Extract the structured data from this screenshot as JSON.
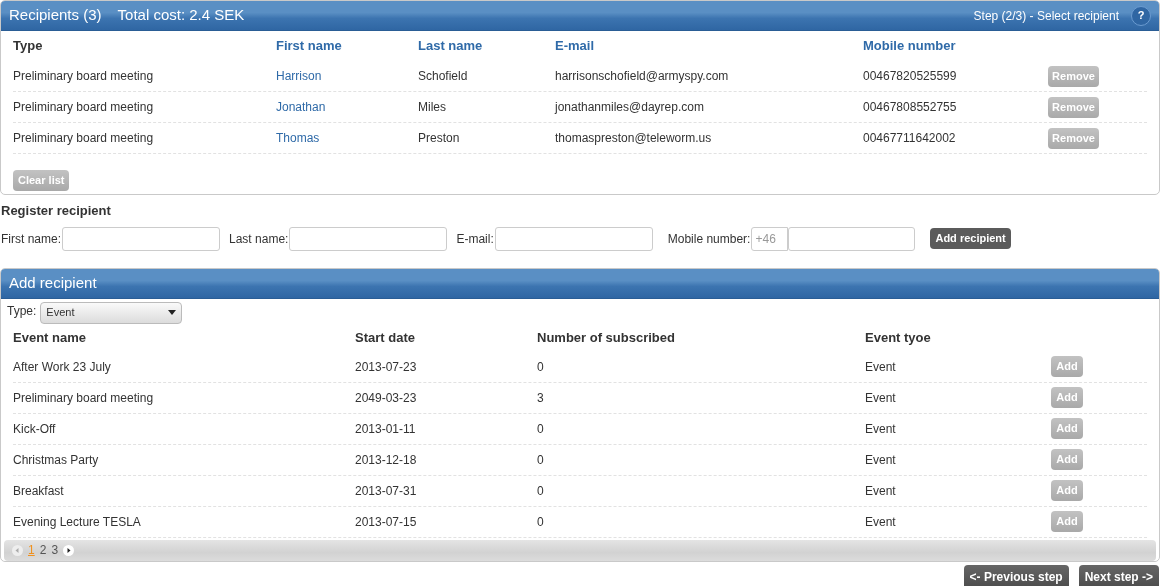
{
  "recipients_panel": {
    "title": "Recipients (3)",
    "total_cost": "Total cost: 2.4 SEK",
    "step": "Step (2/3) - Select recipient",
    "help": "?",
    "columns": [
      {
        "label": "Type",
        "sortable": false
      },
      {
        "label": "First name",
        "sortable": true
      },
      {
        "label": "Last name",
        "sortable": true
      },
      {
        "label": "E-mail",
        "sortable": true
      },
      {
        "label": "Mobile number",
        "sortable": true
      }
    ],
    "rows": [
      {
        "type": "Preliminary board meeting",
        "first_name": "Harrison",
        "last_name": "Schofield",
        "email": "harrisonschofield@armyspy.com",
        "mobile": "00467820525599",
        "action": "Remove"
      },
      {
        "type": "Preliminary board meeting",
        "first_name": "Jonathan",
        "last_name": "Miles",
        "email": "jonathanmiles@dayrep.com",
        "mobile": "00467808552755",
        "action": "Remove"
      },
      {
        "type": "Preliminary board meeting",
        "first_name": "Thomas",
        "last_name": "Preston",
        "email": "thomaspreston@teleworm.us",
        "mobile": "00467711642002",
        "action": "Remove"
      }
    ],
    "clear_button": "Clear list"
  },
  "register": {
    "title": "Register recipient",
    "fields": [
      {
        "label": "First name:"
      },
      {
        "label": "Last name:"
      },
      {
        "label": "E-mail:"
      },
      {
        "label": "Mobile number:",
        "prefix": "+46"
      }
    ],
    "button": "Add recipient"
  },
  "add_panel": {
    "title": "Add recipient",
    "type_label": "Type:",
    "type_value": "Event",
    "columns": [
      "Event name",
      "Start date",
      "Number of subscribed",
      "Event tyoe"
    ],
    "rows": [
      {
        "name": "After Work 23 July",
        "start": "2013-07-23",
        "subscribed": "0",
        "event_type": "Event",
        "action": "Add"
      },
      {
        "name": "Preliminary board meeting",
        "start": "2049-03-23",
        "subscribed": "3",
        "event_type": "Event",
        "action": "Add"
      },
      {
        "name": "Kick-Off",
        "start": "2013-01-11",
        "subscribed": "0",
        "event_type": "Event",
        "action": "Add"
      },
      {
        "name": "Christmas Party",
        "start": "2013-12-18",
        "subscribed": "0",
        "event_type": "Event",
        "action": "Add"
      },
      {
        "name": "Breakfast",
        "start": "2013-07-31",
        "subscribed": "0",
        "event_type": "Event",
        "action": "Add"
      },
      {
        "name": "Evening Lecture TESLA",
        "start": "2013-07-15",
        "subscribed": "0",
        "event_type": "Event",
        "action": "Add"
      }
    ],
    "pages": [
      {
        "label": "1",
        "selected": true
      },
      {
        "label": "2",
        "selected": false
      },
      {
        "label": "3",
        "selected": false
      }
    ]
  },
  "footer": {
    "previous": "<- Previous step",
    "next": "Next step ->"
  }
}
